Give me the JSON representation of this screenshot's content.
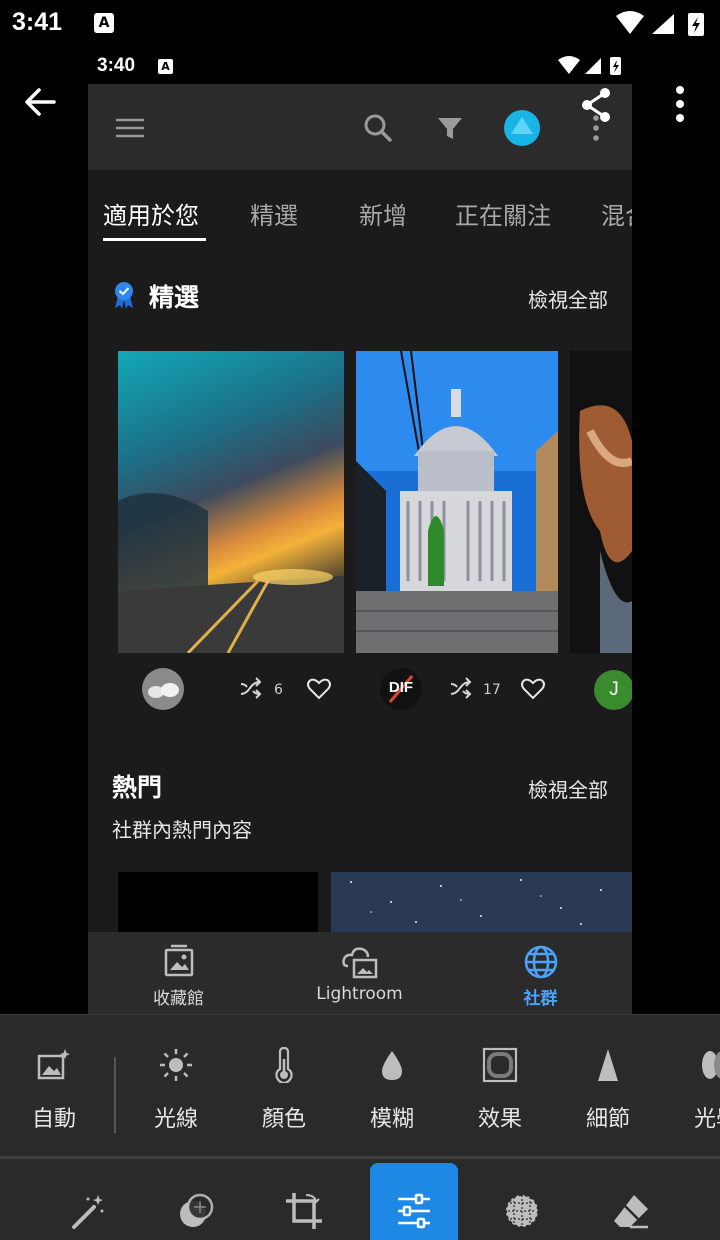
{
  "outer_status": {
    "time": "3:41",
    "badge": "A"
  },
  "inner_status": {
    "time": "3:40",
    "badge": "A"
  },
  "tabs": [
    {
      "label": "適用於您",
      "active": true
    },
    {
      "label": "精選",
      "active": false
    },
    {
      "label": "新增",
      "active": false
    },
    {
      "label": "正在關注",
      "active": false
    },
    {
      "label": "混合",
      "active": false
    }
  ],
  "featured": {
    "title": "精選",
    "view_all": "檢視全部",
    "cards": [
      {
        "remix_count": "6"
      },
      {
        "remix_count": "17",
        "avatar_text": "DIF"
      },
      {
        "avatar_text": "J"
      }
    ]
  },
  "popular": {
    "title": "熱門",
    "view_all": "檢視全部",
    "subtitle": "社群內熱門內容"
  },
  "bottom_nav": [
    {
      "label": "收藏館",
      "icon": "library-icon",
      "active": false
    },
    {
      "label": "Lightroom",
      "icon": "cloud-photo-icon",
      "active": false
    },
    {
      "label": "社群",
      "icon": "globe-icon",
      "active": true
    }
  ],
  "edit_tools": [
    {
      "label": "自動",
      "icon": "auto-icon"
    },
    {
      "label": "光線",
      "icon": "light-icon"
    },
    {
      "label": "顏色",
      "icon": "color-temperature-icon"
    },
    {
      "label": "模糊",
      "icon": "blur-drop-icon"
    },
    {
      "label": "效果",
      "icon": "effects-icon"
    },
    {
      "label": "細節",
      "icon": "detail-icon"
    },
    {
      "label": "光學",
      "icon": "optics-icon"
    }
  ],
  "modes": [
    {
      "icon": "magic-wand-icon",
      "active": false
    },
    {
      "icon": "healing-icon",
      "active": false
    },
    {
      "icon": "crop-icon",
      "active": false
    },
    {
      "icon": "sliders-icon",
      "active": true
    },
    {
      "icon": "selective-icon",
      "active": false
    },
    {
      "icon": "eraser-icon",
      "active": false
    }
  ],
  "colors": {
    "accent": "#4aa3ff",
    "active_mode": "#1e88e5",
    "avatar_j": "#3a8a2e"
  }
}
